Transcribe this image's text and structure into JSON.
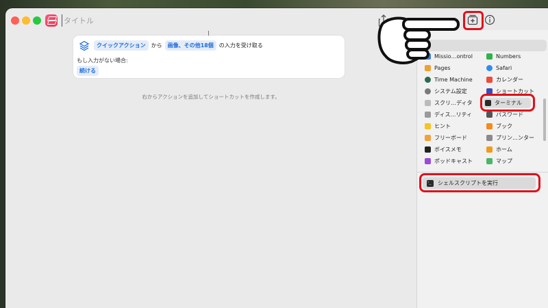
{
  "window": {
    "title_placeholder": "タイトル"
  },
  "toolbar": {
    "share_icon": "share-icon",
    "library_icon": "add-library-icon",
    "info_icon": "info-icon"
  },
  "action": {
    "source_chip": "クイックアクション",
    "from_text": "から",
    "types_chip": "画像、その他18個",
    "receive_text": "の入力を受け取る",
    "no_input_label": "もし入力がない場合:",
    "continue_chip": "続ける"
  },
  "hint": "右からアクションを追加してショートカットを作成します。",
  "sidebar": {
    "search_placeholder": "",
    "left_apps": [
      {
        "label": "Missio…ontrol",
        "color": "#3b7bd8"
      },
      {
        "label": "Pages",
        "color": "#f0a030"
      },
      {
        "label": "Time Machine",
        "color": "#2a6b50"
      },
      {
        "label": "システム設定",
        "color": "#7a7a7a"
      },
      {
        "label": "スクリ…ディタ",
        "color": "#bbbbbb"
      },
      {
        "label": "ディス…リティ",
        "color": "#9a9a9a"
      },
      {
        "label": "ヒント",
        "color": "#f6c423"
      },
      {
        "label": "フリーボード",
        "color": "#f4a03a"
      },
      {
        "label": "ボイスメモ",
        "color": "#222222"
      },
      {
        "label": "ポッドキャスト",
        "color": "#9a4cd8"
      }
    ],
    "right_apps": [
      {
        "label": "Numbers",
        "color": "#2fb34a"
      },
      {
        "label": "Safari",
        "color": "#2d8cf0"
      },
      {
        "label": "カレンダー",
        "color": "#f04a3a"
      },
      {
        "label": "ショートカット",
        "color": "#3a4cb8"
      },
      {
        "label": "ターミナル",
        "color": "#2a2a2a"
      },
      {
        "label": "パスワード",
        "color": "#555555"
      },
      {
        "label": "ブック",
        "color": "#f58a1e"
      },
      {
        "label": "プリン…ンター",
        "color": "#8a8a8a"
      },
      {
        "label": "ホーム",
        "color": "#f29a1c"
      },
      {
        "label": "マップ",
        "color": "#4bb56a"
      }
    ],
    "result": "シェルスクリプトを実行"
  },
  "colors": {
    "accent_red": "#e0101a",
    "chip_blue": "#1d6bd8"
  }
}
